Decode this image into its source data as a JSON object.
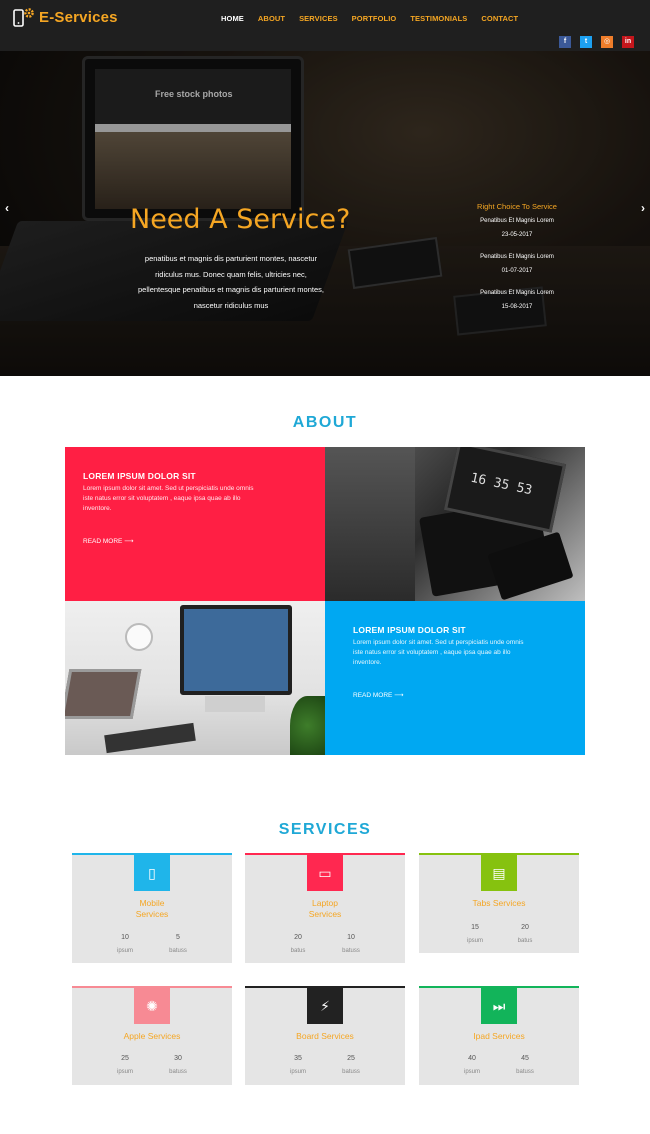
{
  "nav": {
    "logo": "E-Services",
    "menu": [
      "HOME",
      "ABOUT",
      "SERVICES",
      "PORTFOLIO",
      "TESTIMONIALS",
      "CONTACT"
    ],
    "social": [
      {
        "icon": "facebook-icon",
        "glyph": "f",
        "color": "#3b5998"
      },
      {
        "icon": "twitter-icon",
        "glyph": "t",
        "color": "#1da1f2"
      },
      {
        "icon": "instagram-icon",
        "glyph": "◎",
        "color": "#ef7d2a"
      },
      {
        "icon": "linkedin-icon",
        "glyph": "in",
        "color": "#c4161c"
      }
    ]
  },
  "hero": {
    "title": "Need A Service?",
    "text": "penatibus et magnis dis parturient montes, nascetur ridiculus mus. Donec quam felis, ultricies nec, pellentesque penatibus et magnis dis parturient montes, nascetur ridiculus mus",
    "laptop_text": "Free stock photos",
    "side_title": "Right Choice To Service",
    "side_items": [
      {
        "label": "Penatibus Et Magnis Lorem",
        "date": "23-05-2017"
      },
      {
        "label": "Penatibus Et Magnis Lorem",
        "date": "01-07-2017"
      },
      {
        "label": "Penatibus Et Magnis Lorem",
        "date": "15-08-2017"
      }
    ],
    "prev": "‹",
    "next": "›"
  },
  "about": {
    "title": "ABOUT",
    "blocks": [
      {
        "heading": "LOREM IPSUM DOLOR SIT",
        "text": "Lorem ipsum dolor sit amet. Sed ut perspiciatis unde omnis iste natus error sit voluptatem , eaque ipsa quae ab illo inventore.",
        "link": "READ MORE",
        "link_arrow": "⟶"
      },
      {
        "heading": "LOREM IPSUM DOLOR SIT",
        "text": "Lorem ipsum dolor sit amet. Sed ut perspiciatis unde omnis iste natus error sit voluptatem , eaque ipsa quae ab illo inventore.",
        "link": "READ MORE",
        "link_arrow": "⟶"
      }
    ],
    "clock": "16 35 53"
  },
  "services": {
    "title": "SERVICES",
    "cards": [
      {
        "title_lines": [
          "Mobile",
          "Services"
        ],
        "color": "#1fb5ea",
        "icon": "mobile-icon",
        "glyph": "▯",
        "stats": [
          {
            "v": "10",
            "l": "ipsum"
          },
          {
            "v": "5",
            "l": "batuss"
          }
        ]
      },
      {
        "title_lines": [
          "Laptop",
          "Services"
        ],
        "color": "#ff2850",
        "icon": "laptop-icon",
        "glyph": "▭",
        "stats": [
          {
            "v": "20",
            "l": "batus"
          },
          {
            "v": "10",
            "l": "batuss"
          }
        ]
      },
      {
        "title_lines": [
          "Tabs Services"
        ],
        "color": "#86c20f",
        "icon": "tablet-icon",
        "glyph": "▤",
        "stats": [
          {
            "v": "15",
            "l": "ipsum"
          },
          {
            "v": "20",
            "l": "batus"
          }
        ]
      },
      {
        "title_lines": [
          "Apple Services"
        ],
        "color": "#f78a94",
        "icon": "apple-icon",
        "glyph": "✺",
        "stats": [
          {
            "v": "25",
            "l": "ipsum"
          },
          {
            "v": "30",
            "l": "batuss"
          }
        ]
      },
      {
        "title_lines": [
          "Board Services"
        ],
        "color": "#222222",
        "icon": "plug-icon",
        "glyph": "⚡",
        "stats": [
          {
            "v": "35",
            "l": "ipsum"
          },
          {
            "v": "25",
            "l": "batuss"
          }
        ]
      },
      {
        "title_lines": [
          "Ipad Services"
        ],
        "color": "#12b45a",
        "icon": "fast-forward-icon",
        "glyph": "⏭",
        "stats": [
          {
            "v": "40",
            "l": "ipsum"
          },
          {
            "v": "45",
            "l": "batuss"
          }
        ]
      }
    ]
  }
}
